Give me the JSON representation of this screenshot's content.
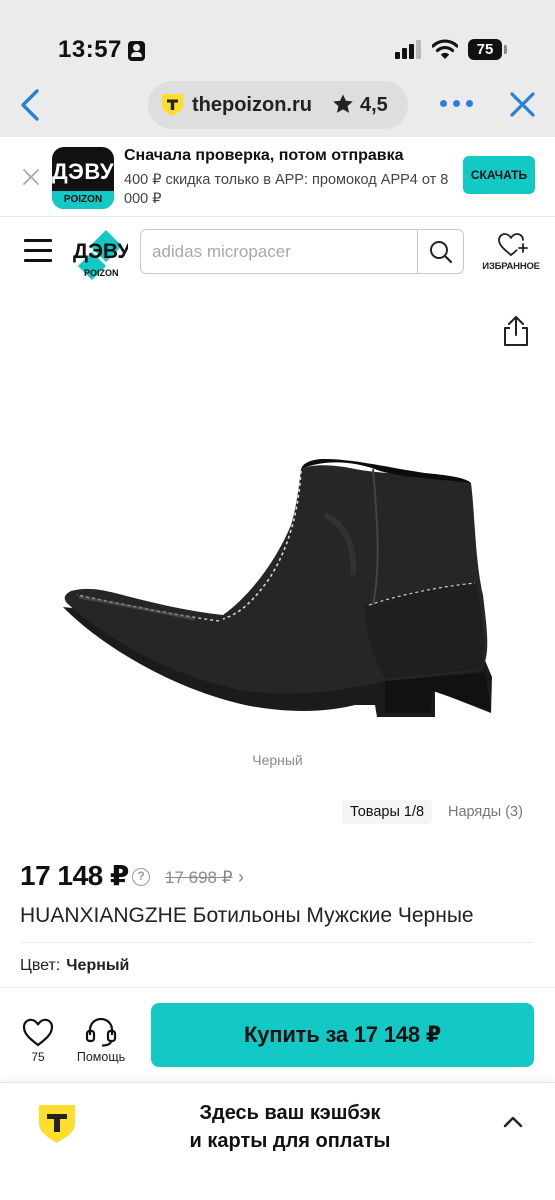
{
  "status_bar": {
    "time": "13:57",
    "battery": "75"
  },
  "browser": {
    "domain": "thepoizon.ru",
    "rating": "4,5"
  },
  "app_banner": {
    "logo_main": "ДЭВУ",
    "logo_sub": "POIZON",
    "title": "Сначала проверка, потом отправка",
    "promo": "400 ₽ скидка только в APP: промокод APP4 от 8 000 ₽",
    "download_label": "СКАЧАТЬ"
  },
  "header": {
    "logo_main": "ДЭВУ",
    "logo_sub": "POIZON",
    "search_placeholder": "adidas micropacer",
    "favorites_label": "ИЗБРАННОЕ"
  },
  "product": {
    "image_caption": "Черный",
    "products_counter": "Товары 1/8",
    "outfits_counter": "Наряды (3)",
    "price": "17 148 ₽",
    "info_symbol": "?",
    "old_price": "17 698 ₽",
    "old_price_chevron": "›",
    "title": "HUANXIANGZHE Ботильоны Мужские Черные",
    "color_label": "Цвет:",
    "color_value": "Черный"
  },
  "actions": {
    "favorites_count": "75",
    "help_label": "Помощь",
    "buy_label": "Купить за 17 148 ₽"
  },
  "cashback": {
    "line1": "Здесь ваш кэшбэк",
    "line2": "и карты для оплаты"
  },
  "colors": {
    "accent": "#13c9c6",
    "browser_blue": "#2a80d8",
    "tbank_yellow": "#ffdd2d"
  }
}
